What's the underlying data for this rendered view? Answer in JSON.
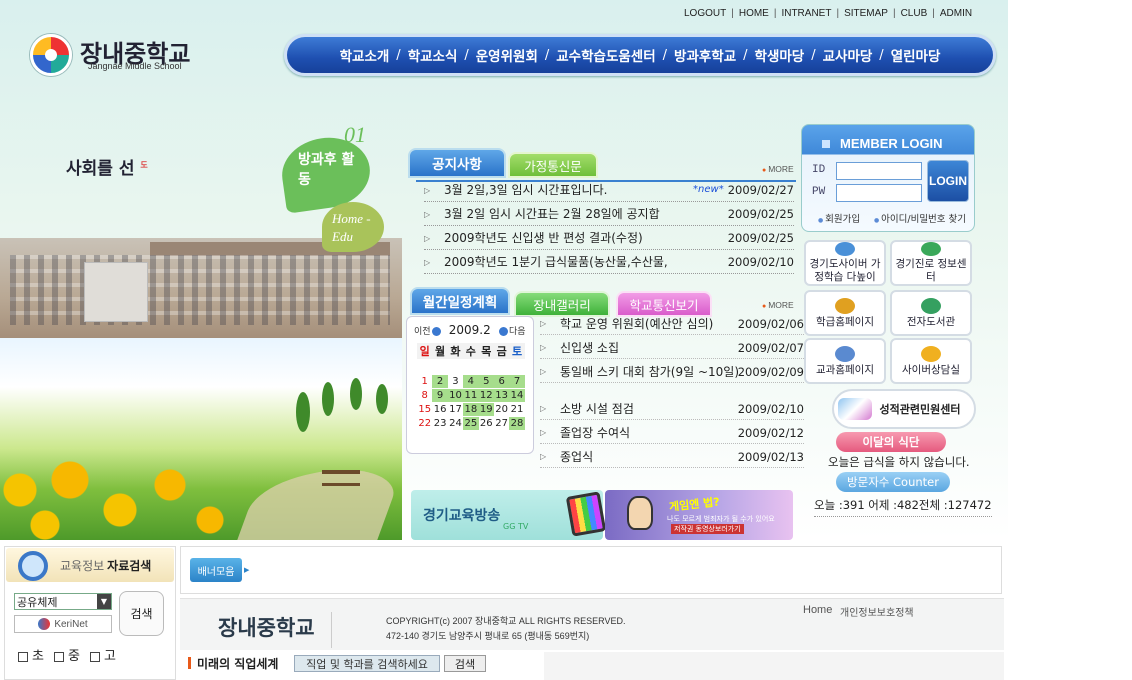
{
  "top_links": [
    "LOGOUT",
    "HOME",
    "INTRANET",
    "SITEMAP",
    "CLUB",
    "ADMIN"
  ],
  "logo": {
    "name_ko": "장내중학교",
    "name_en": "Jangnae Middle School"
  },
  "main_nav": [
    "학교소개",
    "학교소식",
    "운영위원회",
    "교수학습도움센터",
    "방과후학교",
    "학생마당",
    "교사마당",
    "열린마당"
  ],
  "visual": {
    "slogan": "사회를 선",
    "slogan_mark": "도",
    "bubble1_number": "01",
    "bubble1_text": "방과후 활동",
    "bubble2_text": "Home -Edu"
  },
  "notice_board": {
    "tabs": [
      "공지사항",
      "가정통신문"
    ],
    "more_label": "MORE",
    "items": [
      {
        "title": "3월 2일,3일 임시 시간표입니다.",
        "badge": "*new*",
        "date": "2009/02/27"
      },
      {
        "title": "3월 2일 임시 시간표는 2월 28일에 공지합",
        "badge": "",
        "date": "2009/02/25"
      },
      {
        "title": "2009학년도 신입생 반 편성 결과(수정)",
        "badge": "",
        "date": "2009/02/25"
      },
      {
        "title": "2009학년도 1분기 급식물품(농산물,수산물,",
        "badge": "",
        "date": "2009/02/10"
      }
    ]
  },
  "schedule": {
    "tabs": [
      "월간일정계획",
      "장내갤러리",
      "학교통신보기"
    ],
    "more_label": "MORE",
    "calendar": {
      "prev_label": "이전",
      "next_label": "다음",
      "month": "2009.2",
      "weekdays": [
        "일",
        "월",
        "화",
        "수",
        "목",
        "금",
        "토"
      ],
      "days": [
        "1",
        "2",
        "3",
        "4",
        "5",
        "6",
        "7",
        "8",
        "9",
        "10",
        "11",
        "12",
        "13",
        "14",
        "15",
        "16",
        "17",
        "18",
        "19",
        "20",
        "21",
        "22",
        "23",
        "24",
        "25",
        "26",
        "27",
        "28"
      ],
      "event_days": [
        "2",
        "4",
        "5",
        "6",
        "7",
        "9",
        "10",
        "11",
        "12",
        "13",
        "14",
        "18",
        "19",
        "25",
        "28"
      ]
    },
    "items": [
      {
        "title": "학교 운영 위원회(예산안 심의)",
        "date": "2009/02/06"
      },
      {
        "title": "신입생 소집",
        "date": "2009/02/07"
      },
      {
        "title": "통일배 스키 대회 참가(9일 ~10일)",
        "date": "2009/02/09"
      },
      {
        "title": "소방 시설 점검",
        "date": "2009/02/10"
      },
      {
        "title": "졸업장 수여식",
        "date": "2009/02/12"
      },
      {
        "title": "종업식",
        "date": "2009/02/13"
      }
    ]
  },
  "login": {
    "title": "MEMBER LOGIN",
    "id_label": "ID",
    "pw_label": "PW",
    "button_label": "LOGIN",
    "links": [
      "회원가입",
      "아이디/비밀번호 찾기"
    ]
  },
  "quick_links": [
    {
      "label": "경기도사이버 가정학습 다높이",
      "icon": "cyber-learning-icon"
    },
    {
      "label": "경기진로 정보센터",
      "icon": "career-center-icon"
    },
    {
      "label": "학급홈페이지",
      "icon": "class-homepage-icon"
    },
    {
      "label": "전자도서관",
      "icon": "e-library-icon"
    },
    {
      "label": "교과홈페이지",
      "icon": "subject-homepage-icon"
    },
    {
      "label": "사이버상담실",
      "icon": "cyber-counsel-icon"
    }
  ],
  "grade_complaint": "성적관련민원센터",
  "lunch": {
    "label": "이달의 식단",
    "text": "오늘은 급식을 하지 않습니다."
  },
  "visitors": {
    "label": "방문자수 Counter",
    "text": "오늘 :391 어제 :482전체 :127472"
  },
  "banners": {
    "ggtv_title": "경기교육방송",
    "ggtv_sub": "GG TV",
    "game_title": "게임엔 법?",
    "game_sub1": "나도 모르게 범죄자가 될 수가 있어요",
    "game_sub2": "저작권 동영상보러가기"
  },
  "edu_search": {
    "title_a": "교육정보",
    "title_b": "자료검색",
    "select_value": "공유체제",
    "kerinet_label": "KeriNet",
    "search_button": "검색",
    "levels": [
      "초",
      "중",
      "고"
    ]
  },
  "banner_strip": {
    "more_label": "배너모음"
  },
  "footer": {
    "school_name": "장내중학교",
    "copyright": "COPYRIGHT(c) 2007 장내중학교 ALL RIGHTS RESERVED.",
    "address": "472-140 경기도 남양주시 평내로 65 (평내동 569번지)",
    "home_link": "Home",
    "privacy_link": "개인정보보호정책"
  },
  "career": {
    "title": "미래의 직업세계",
    "input_placeholder": "직업 및 학과를 검색하세요",
    "button_label": "검색"
  },
  "colors": {
    "nav_blue": "#1e4fb0",
    "tab_blue": "#2a73c9",
    "tab_green": "#6fbf3a",
    "tab_pink": "#d95ccb",
    "event_green": "#a6dd8c",
    "more_orange": "#e85a1a"
  }
}
